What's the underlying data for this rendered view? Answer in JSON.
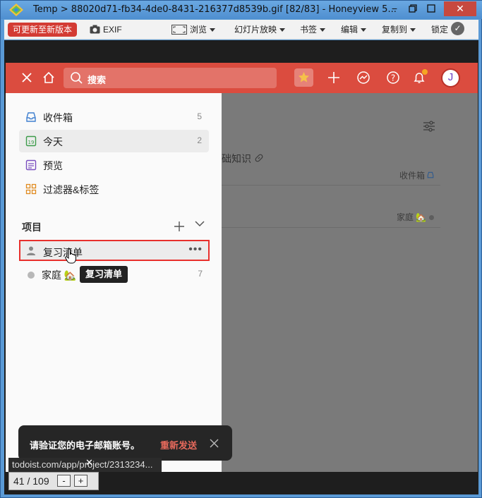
{
  "window": {
    "title": "Temp > 88020d71-fb34-4de0-8431-216377d8539b.gif [82/83] - Honeyview 5...",
    "minimize": "−",
    "maximize": "▣",
    "close": "✕"
  },
  "toolbar": {
    "update_btn": "可更新至新版本",
    "exif": "EXIF",
    "browse": "浏览",
    "slideshow": "幻灯片放映",
    "bookmarks": "书签",
    "edit": "编辑",
    "copy_to": "复制到",
    "lock": "锁定",
    "lock_state": "✓"
  },
  "header": {
    "close_icon": "close-icon",
    "home_icon": "home-icon",
    "search_placeholder": "搜索",
    "avatar_letter": "J"
  },
  "sidebar": {
    "items": [
      {
        "label": "收件箱",
        "count": "5"
      },
      {
        "label": "今天",
        "count": "2"
      },
      {
        "label": "预览",
        "count": ""
      },
      {
        "label": "过滤器&标签",
        "count": ""
      }
    ],
    "projects_header": "项目",
    "projects": [
      {
        "label": "复习清单",
        "count": ""
      },
      {
        "label": "家庭 🏡",
        "count": "7"
      }
    ],
    "tooltip": "复习清单"
  },
  "main": {
    "task_fragment": "础知识",
    "inbox_label": "收件箱",
    "home_label": "家庭 🏡"
  },
  "toast": {
    "message": "请验证您的电子邮箱账号。",
    "resend": "重新发送",
    "close": "✕"
  },
  "status": {
    "url": "todoist.com/app/project/2313234...",
    "page": "41 / 109",
    "minus": "-",
    "plus": "+",
    "close": "✕"
  },
  "colors": {
    "brand": "#db4c3f",
    "toast_bg": "#262626",
    "selection_border": "#e8302c"
  }
}
